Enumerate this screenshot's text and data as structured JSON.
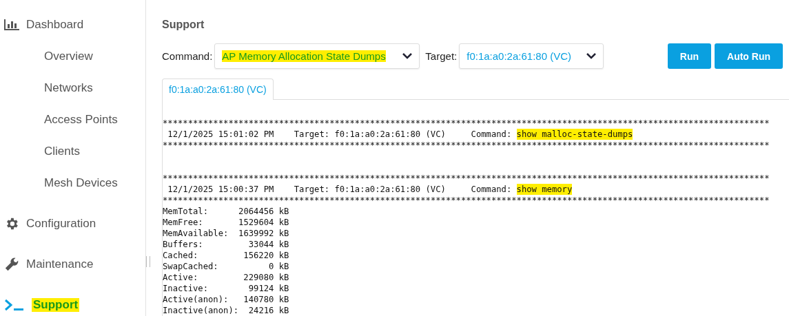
{
  "sidebar": {
    "items": [
      {
        "kind": "chart",
        "label": "Dashboard",
        "selected": false,
        "highlighted": false,
        "children": [
          {
            "label": "Overview",
            "selected": false
          },
          {
            "label": "Networks",
            "selected": false
          },
          {
            "label": "Access Points",
            "selected": false
          },
          {
            "label": "Clients",
            "selected": false
          },
          {
            "label": "Mesh Devices",
            "selected": false
          }
        ]
      },
      {
        "kind": "gear",
        "label": "Configuration",
        "selected": false,
        "highlighted": false
      },
      {
        "kind": "wrench",
        "label": "Maintenance",
        "selected": false,
        "highlighted": false
      },
      {
        "kind": "terminal",
        "label": "Support",
        "selected": true,
        "highlighted": true
      }
    ]
  },
  "page": {
    "title": "Support",
    "command": {
      "label": "Command:",
      "value": "AP Memory Allocation State Dumps",
      "highlighted": true
    },
    "target": {
      "label": "Target:",
      "value": "f0:1a:a0:2a:61:80 (VC)",
      "highlighted": false
    },
    "buttons": [
      "Run",
      "Auto Run"
    ],
    "tabs": [
      {
        "label": "f0:1a:a0:2a:61:80 (VC)",
        "selected": true
      }
    ],
    "output": [
      {
        "kind": "blank"
      },
      {
        "kind": "rule",
        "text": "************************************************************************************************************************"
      },
      {
        "kind": "header",
        "time": "12/1/2025 15:01:02 PM",
        "target": "Target: f0:1a:a0:2a:61:80 (VC)",
        "command_label": "Command:",
        "command": "show malloc-state-dumps",
        "highlighted": true
      },
      {
        "kind": "rule",
        "text": "************************************************************************************************************************"
      },
      {
        "kind": "blank"
      },
      {
        "kind": "blank"
      },
      {
        "kind": "rule",
        "text": "************************************************************************************************************************"
      },
      {
        "kind": "header",
        "time": "12/1/2025 15:00:37 PM",
        "target": "Target: f0:1a:a0:2a:61:80 (VC)",
        "command_label": "Command:",
        "command": "show memory",
        "highlighted": true
      },
      {
        "kind": "rule",
        "text": "************************************************************************************************************************"
      },
      {
        "kind": "stat",
        "label": "MemTotal:",
        "value": "2064456 kB"
      },
      {
        "kind": "stat",
        "label": "MemFree:",
        "value": "1529604 kB"
      },
      {
        "kind": "stat",
        "label": "MemAvailable:",
        "value": "1639992 kB"
      },
      {
        "kind": "stat",
        "label": "Buffers:",
        "value": "33044 kB"
      },
      {
        "kind": "stat",
        "label": "Cached:",
        "value": "156220 kB"
      },
      {
        "kind": "stat",
        "label": "SwapCached:",
        "value": "0 kB"
      },
      {
        "kind": "stat",
        "label": "Active:",
        "value": "229080 kB"
      },
      {
        "kind": "stat",
        "label": "Inactive:",
        "value": "99124 kB"
      },
      {
        "kind": "stat",
        "label": "Active(anon):",
        "value": "140780 kB"
      },
      {
        "kind": "stat",
        "label": "Inactive(anon):",
        "value": "24216 kB"
      }
    ]
  }
}
